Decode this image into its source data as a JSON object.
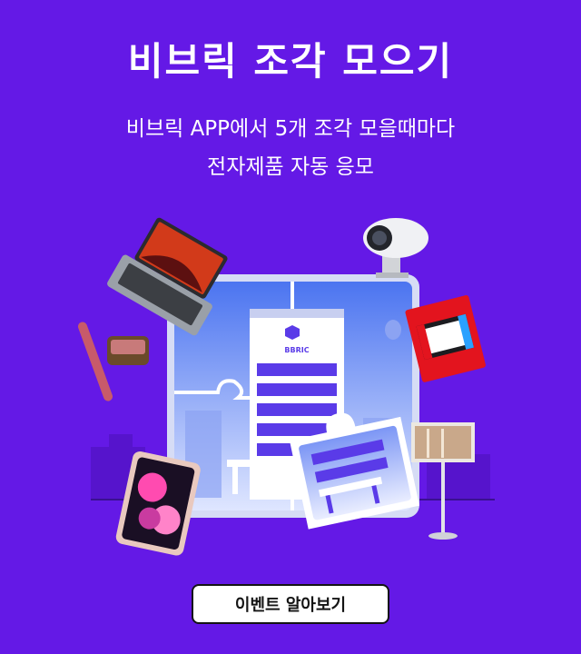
{
  "header": {
    "title": "비브릭 조각 모으기",
    "subtitle_line1": "비브릭 APP에서 5개 조각 모을때마다",
    "subtitle_line2": "전자제품 자동 응모"
  },
  "illustration": {
    "building_logo_text": "BBRIC"
  },
  "cta": {
    "label": "이벤트 알아보기"
  },
  "colors": {
    "background": "#6419e6",
    "puzzle_sky_top": "#4b74f0",
    "puzzle_sky_bottom": "#dfe6ff",
    "building_stripe": "#5a3be8"
  }
}
